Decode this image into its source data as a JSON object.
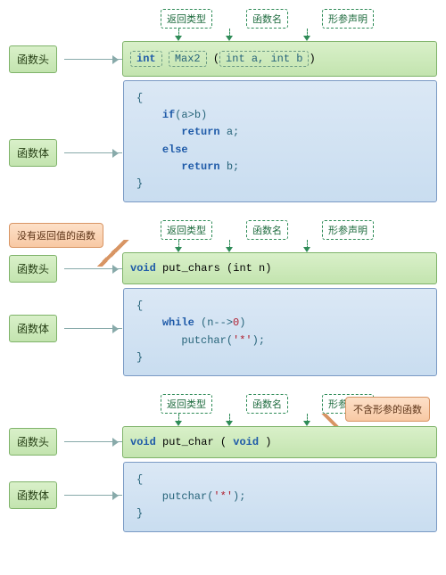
{
  "labels": {
    "returnType": "返回类型",
    "funcName": "函数名",
    "paramDecl": "形参声明",
    "header": "函数头",
    "body": "函数体",
    "noReturn": "没有返回值的函数",
    "noParam": "不含形参的函数"
  },
  "ex1": {
    "ret": "int",
    "name": "Max2",
    "lp": "(",
    "params": "int a, int b",
    "rp": ")",
    "body_lbrace": "{",
    "body_l1a": "    ",
    "body_l1b": "if",
    "body_l1c": "(a>b)",
    "body_l2a": "       ",
    "body_l2b": "return",
    "body_l2c": " a;",
    "body_l3a": "    ",
    "body_l3b": "else",
    "body_l4a": "       ",
    "body_l4b": "return",
    "body_l4c": " b;",
    "body_rbrace": "}"
  },
  "ex2": {
    "ret": "void",
    "name": " put_chars ",
    "lp": "(",
    "params": "int n",
    "rp": ")",
    "body_lbrace": "{",
    "body_l1a": "    ",
    "body_l1b": "while",
    "body_l1c": " (n-->",
    "body_zero": "0",
    "body_l1d": ")",
    "body_l2a": "       putchar(",
    "body_star": "'*'",
    "body_l2b": ");",
    "body_rbrace": "}"
  },
  "ex3": {
    "ret": "void",
    "name": "  put_char ",
    "lp": "( ",
    "params": "void",
    "rp": " )",
    "body_lbrace": "{",
    "body_l1a": "    putchar(",
    "body_star": "'*'",
    "body_l1b": ");",
    "body_rbrace": "}"
  }
}
